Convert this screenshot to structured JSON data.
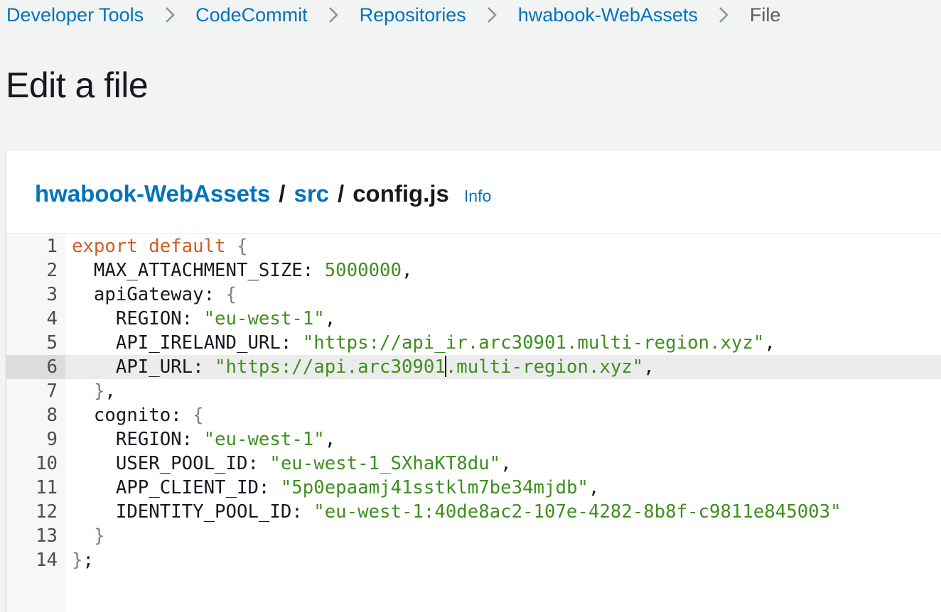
{
  "breadcrumb": {
    "items": [
      {
        "label": "Developer Tools"
      },
      {
        "label": "CodeCommit"
      },
      {
        "label": "Repositories"
      },
      {
        "label": "hwabook-WebAssets"
      }
    ],
    "current": "File"
  },
  "page": {
    "title": "Edit a file"
  },
  "file_path": {
    "repo": "hwabook-WebAssets",
    "folder": "src",
    "file": "config.js",
    "separator": "/",
    "info_label": "Info"
  },
  "editor": {
    "active_line": 6,
    "lines": [
      {
        "n": "1",
        "t": [
          {
            "c": "kw",
            "v": "export default"
          },
          {
            "c": "",
            "v": " "
          },
          {
            "c": "brace",
            "v": "{"
          }
        ]
      },
      {
        "n": "2",
        "t": [
          {
            "c": "",
            "v": "  MAX_ATTACHMENT_SIZE: "
          },
          {
            "c": "num",
            "v": "5000000"
          },
          {
            "c": "",
            "v": ","
          }
        ]
      },
      {
        "n": "3",
        "t": [
          {
            "c": "",
            "v": "  apiGateway: "
          },
          {
            "c": "brace",
            "v": "{"
          }
        ]
      },
      {
        "n": "4",
        "t": [
          {
            "c": "",
            "v": "    REGION: "
          },
          {
            "c": "str",
            "v": "\"eu-west-1\""
          },
          {
            "c": "",
            "v": ","
          }
        ]
      },
      {
        "n": "5",
        "t": [
          {
            "c": "",
            "v": "    API_IRELAND_URL: "
          },
          {
            "c": "str",
            "v": "\"https://api_ir.arc30901.multi-region.xyz\""
          },
          {
            "c": "",
            "v": ","
          }
        ]
      },
      {
        "n": "6",
        "t": [
          {
            "c": "",
            "v": "    API_URL: "
          },
          {
            "c": "str",
            "v": "\"https://api.arc30901"
          },
          {
            "c": "cursor",
            "v": ""
          },
          {
            "c": "str",
            "v": ".multi-region.xyz\""
          },
          {
            "c": "",
            "v": ","
          }
        ]
      },
      {
        "n": "7",
        "t": [
          {
            "c": "",
            "v": "  "
          },
          {
            "c": "brace",
            "v": "}"
          },
          {
            "c": "",
            "v": ","
          }
        ]
      },
      {
        "n": "8",
        "t": [
          {
            "c": "",
            "v": "  cognito: "
          },
          {
            "c": "brace",
            "v": "{"
          }
        ]
      },
      {
        "n": "9",
        "t": [
          {
            "c": "",
            "v": "    REGION: "
          },
          {
            "c": "str",
            "v": "\"eu-west-1\""
          },
          {
            "c": "",
            "v": ","
          }
        ]
      },
      {
        "n": "10",
        "t": [
          {
            "c": "",
            "v": "    USER_POOL_ID: "
          },
          {
            "c": "str",
            "v": "\"eu-west-1_SXhaKT8du\""
          },
          {
            "c": "",
            "v": ","
          }
        ]
      },
      {
        "n": "11",
        "t": [
          {
            "c": "",
            "v": "    APP_CLIENT_ID: "
          },
          {
            "c": "str",
            "v": "\"5p0epaamj41sstklm7be34mjdb\""
          },
          {
            "c": "",
            "v": ","
          }
        ]
      },
      {
        "n": "12",
        "t": [
          {
            "c": "",
            "v": "    IDENTITY_POOL_ID: "
          },
          {
            "c": "str",
            "v": "\"eu-west-1:40de8ac2-107e-4282-8b8f-c9811e845003\""
          }
        ]
      },
      {
        "n": "13",
        "t": [
          {
            "c": "",
            "v": "  "
          },
          {
            "c": "brace",
            "v": "}"
          }
        ]
      },
      {
        "n": "14",
        "t": [
          {
            "c": "brace",
            "v": "}"
          },
          {
            "c": "",
            "v": ";"
          }
        ]
      }
    ]
  },
  "colors": {
    "link": "#0073bb",
    "keyword": "#d15c1f",
    "string": "#3f8f1f",
    "background": "#f2f3f3"
  }
}
